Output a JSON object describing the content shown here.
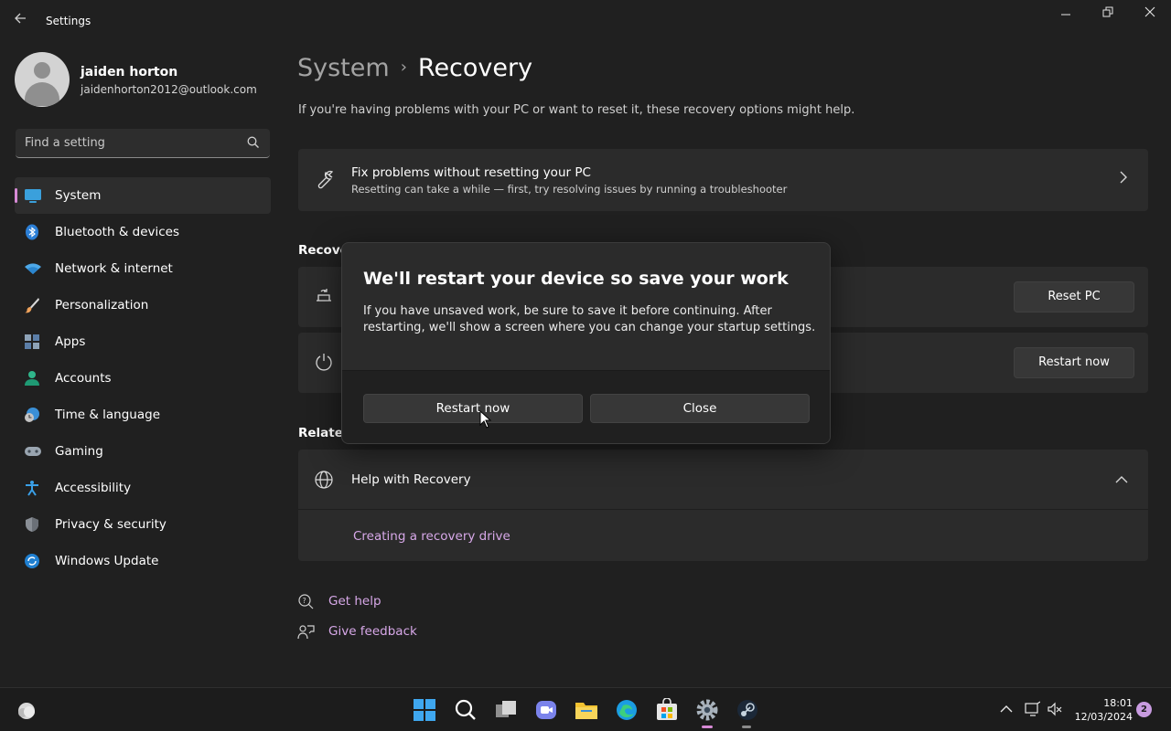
{
  "window": {
    "title": "Settings",
    "back_icon": "arrow-left-icon",
    "minimize_glyph": "—",
    "restore_glyph": "❐",
    "close_glyph": "✕"
  },
  "profile": {
    "name": "jaiden horton",
    "email": "jaidenhorton2012@outlook.com"
  },
  "search": {
    "placeholder": "Find a setting"
  },
  "sidebar": {
    "items": [
      {
        "label": "System",
        "icon": "system-icon",
        "active": true
      },
      {
        "label": "Bluetooth & devices",
        "icon": "bluetooth-icon"
      },
      {
        "label": "Network & internet",
        "icon": "wifi-icon"
      },
      {
        "label": "Personalization",
        "icon": "brush-icon"
      },
      {
        "label": "Apps",
        "icon": "apps-icon"
      },
      {
        "label": "Accounts",
        "icon": "accounts-icon"
      },
      {
        "label": "Time & language",
        "icon": "globe-clock-icon"
      },
      {
        "label": "Gaming",
        "icon": "gamepad-icon"
      },
      {
        "label": "Accessibility",
        "icon": "accessibility-icon"
      },
      {
        "label": "Privacy & security",
        "icon": "shield-icon"
      },
      {
        "label": "Windows Update",
        "icon": "update-icon"
      }
    ]
  },
  "breadcrumb": {
    "parent": "System",
    "separator": "›",
    "current": "Recovery"
  },
  "intro": "If you're having problems with your PC or want to reset it, these recovery options might help.",
  "fix_card": {
    "title": "Fix problems without resetting your PC",
    "subtitle": "Resetting can take a while — first, try resolving issues by running a troubleshooter"
  },
  "recovery_section": {
    "heading": "Recover",
    "reset_button": "Reset PC",
    "restart_button": "Restart now"
  },
  "related_section": {
    "heading": "Related",
    "help_title": "Help with Recovery",
    "help_link": "Creating a recovery drive"
  },
  "footer_links": {
    "get_help": "Get help",
    "give_feedback": "Give feedback"
  },
  "dialog": {
    "title": "We'll restart your device so save your work",
    "body": "If you have unsaved work, be sure to save it before continuing. After restarting, we'll show a screen where you can change your startup settings.",
    "primary_button": "Restart now",
    "secondary_button": "Close"
  },
  "taskbar": {
    "clock_time": "18:01",
    "clock_date": "12/03/2024",
    "notification_count": "2"
  },
  "colors": {
    "accent": "#d78ad6",
    "link": "#d7a8e8",
    "background": "#202020",
    "card": "#2b2b2b"
  }
}
